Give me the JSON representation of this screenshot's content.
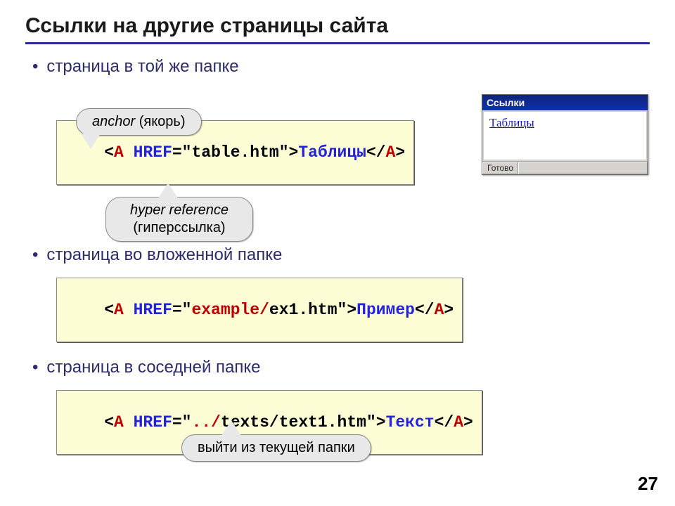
{
  "title": "Ссылки на другие страницы сайта",
  "bullets": {
    "b1": "страница в той же папке",
    "b2": "страница во вложенной папке",
    "b3": "страница в соседней папке"
  },
  "tooltips": {
    "anchor_it": "anchor",
    "anchor_ru": " (якорь)",
    "href_it": "hyper reference",
    "href_ru": "(гиперссылка)",
    "updir": "выйти из текущей папки"
  },
  "code1": {
    "open_lt": "<",
    "tag_a": "A",
    "sp": " ",
    "attr": "HREF",
    "eq": "=\"",
    "val": "table.htm",
    "endq": "\">",
    "text": "Таблицы",
    "close": "</",
    "close_gt": ">"
  },
  "code2": {
    "open_lt": "<",
    "tag_a": "A",
    "sp": " ",
    "attr": "HREF",
    "eq": "=\"",
    "path": "example/",
    "file": "ex1.htm",
    "endq": "\">",
    "text": "Пример",
    "close": "</",
    "close_gt": ">"
  },
  "code3": {
    "open_lt": "<",
    "tag_a": "A",
    "sp": " ",
    "attr": "HREF",
    "eq": "=\"",
    "dots": "../",
    "path": "texts/text1.htm",
    "endq": "\">",
    "text": "Текст",
    "close": "</",
    "close_gt": ">"
  },
  "mini": {
    "title": "Ссылки",
    "link": "Таблицы",
    "status": "Готово"
  },
  "page_number": "27"
}
